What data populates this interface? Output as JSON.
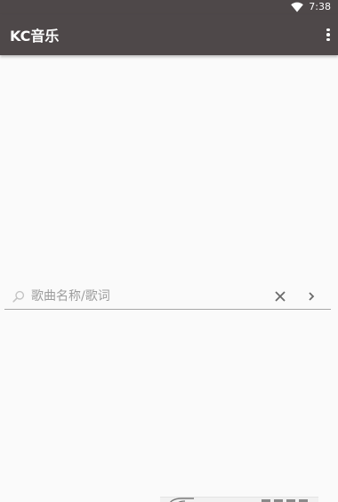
{
  "status_bar": {
    "time": "7:38",
    "wifi_icon": "wifi-icon"
  },
  "app_bar": {
    "title": "KC音乐",
    "menu_icon": "more-vert-icon",
    "color": "#4e4849"
  },
  "search": {
    "placeholder": "歌曲名称/歌词",
    "value": "",
    "search_icon": "search-icon",
    "clear_icon": "close-icon",
    "go_icon": "chevron-right-icon"
  },
  "colors": {
    "background": "#fafafa",
    "toolbar": "#4e4849",
    "placeholder": "#9d9d9d",
    "underline": "#a7a7a7"
  }
}
